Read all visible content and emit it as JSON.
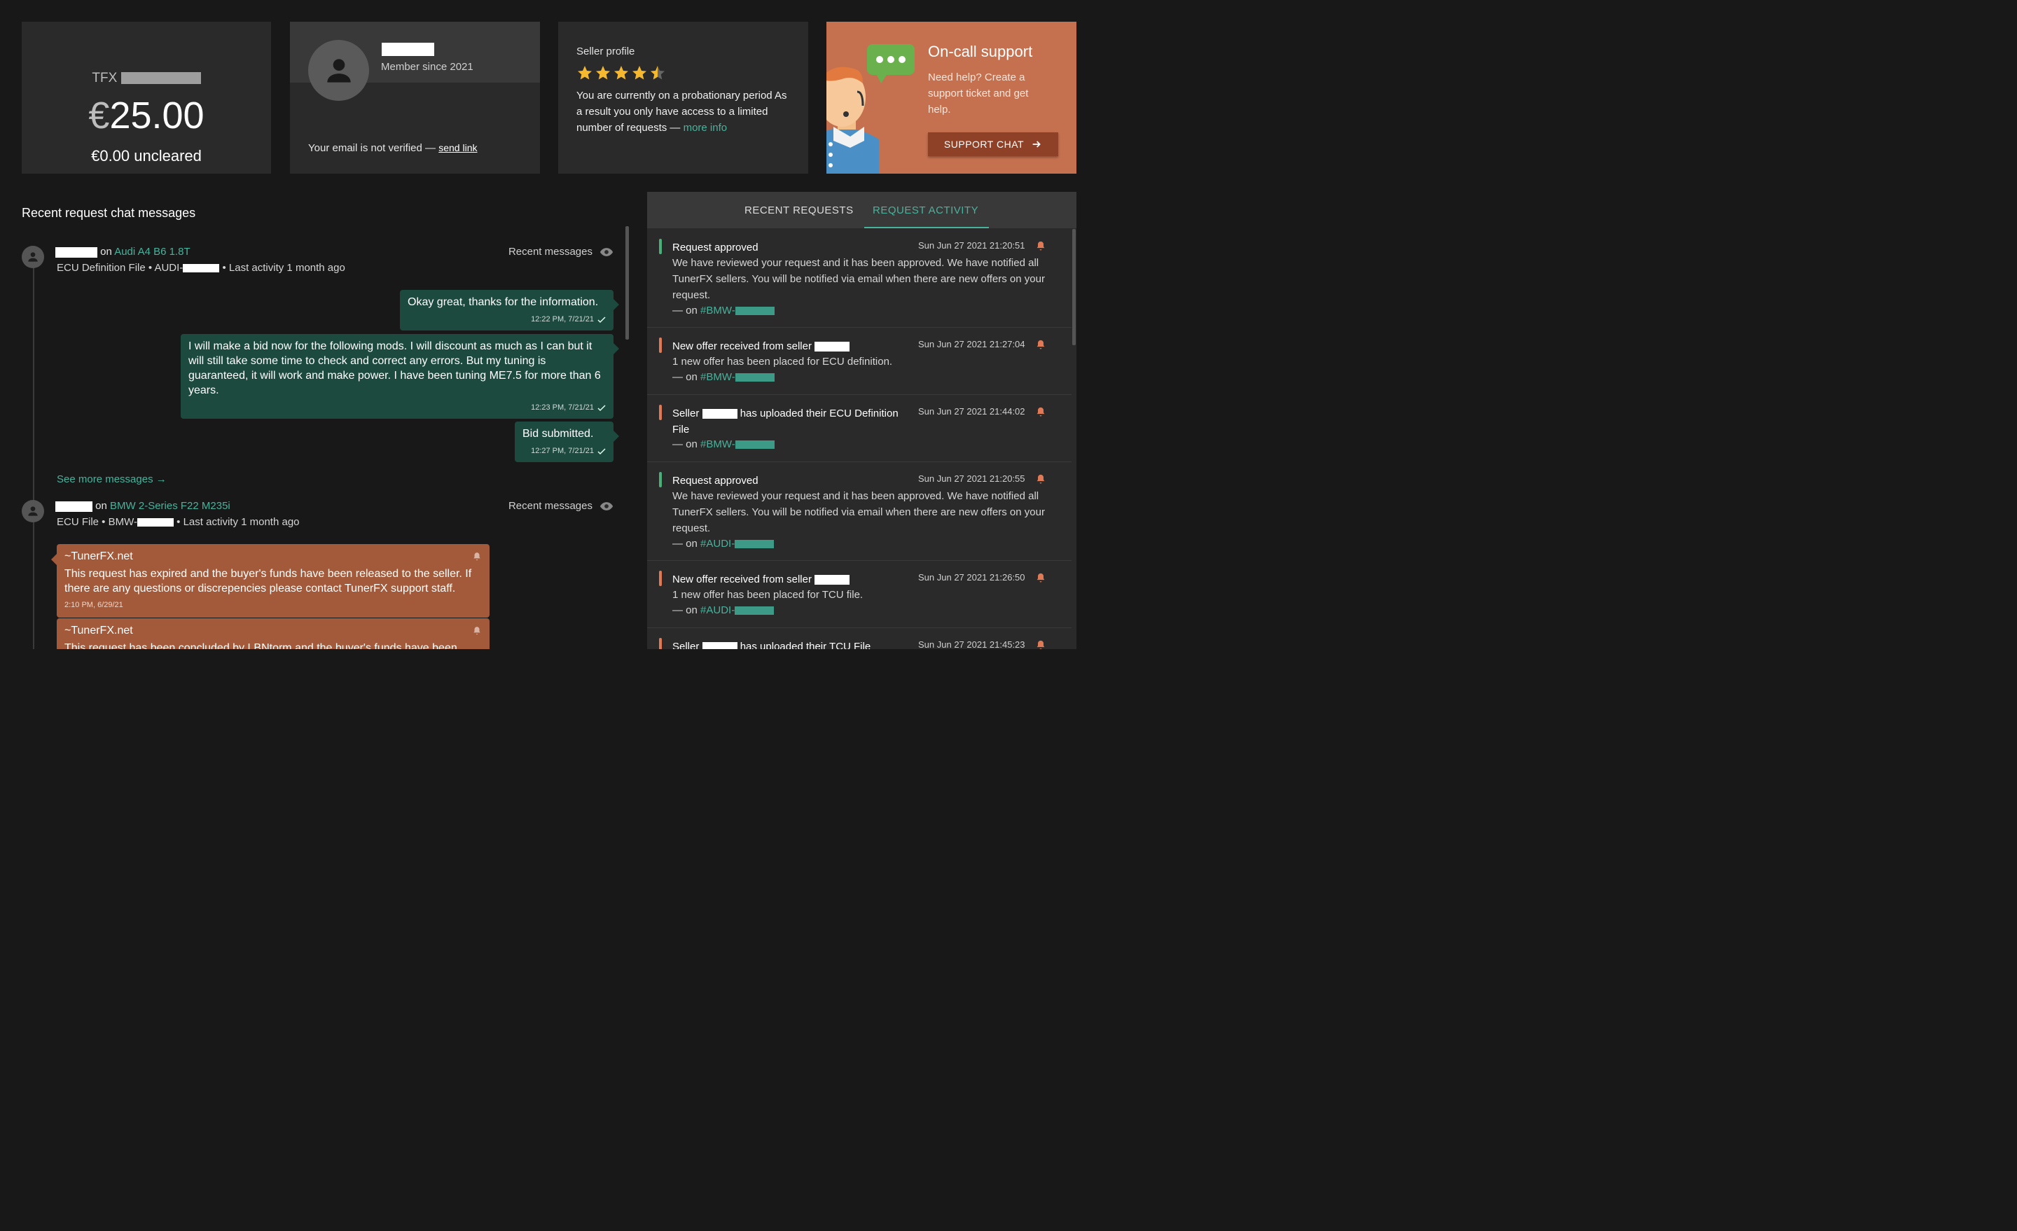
{
  "balance": {
    "currency": "TFX",
    "symbol": "€",
    "amount": "25.00",
    "uncleared": "€0.00 uncleared"
  },
  "profile": {
    "member_since": "Member since 2021",
    "email_status": "Your email is not verified",
    "dash": "—",
    "send_link": "send link"
  },
  "seller": {
    "title": "Seller profile",
    "rating": 4.5,
    "text": "You are currently on a probationary period As a result you only have access to a limited number of requests",
    "dash": "—",
    "more_info": "more info",
    "star_color": "#f5b82e"
  },
  "support": {
    "title": "On-call support",
    "description": "Need help? Create a support ticket and get help.",
    "button": "SUPPORT CHAT",
    "accent": "#c5714f"
  },
  "chat": {
    "title": "Recent request chat messages",
    "recent_messages_label": "Recent messages",
    "see_more": "See more messages →",
    "threads": [
      {
        "on": "on",
        "vehicle": "Audi A4 B6 1.8T",
        "file": "ECU Definition File • AUDI-",
        "activity": "Last activity 1 month ago",
        "messages": [
          {
            "text": "Okay great, thanks for the information.",
            "time": "12:22 PM, 7/21/21"
          },
          {
            "text": "I will make a bid now for the following mods. I will discount as much as I can but it will still take some time to check and correct any errors. But my tuning is guaranteed, it will work and make power. I have been tuning ME7.5 for more than 6 years.",
            "time": "12:23 PM, 7/21/21"
          },
          {
            "text": "Bid submitted.",
            "time": "12:27 PM, 7/21/21"
          }
        ]
      },
      {
        "on": "on",
        "vehicle": "BMW 2-Series F22 M235i",
        "file": "ECU File • BMW-",
        "activity": "Last activity 1 month ago",
        "system_messages": [
          {
            "from": "~TunerFX.net",
            "text": "This request has expired and the buyer's funds have been released to the seller. If there are any questions or discrepencies please contact TunerFX support staff.",
            "time": "2:10 PM, 6/29/21"
          },
          {
            "from": "~TunerFX.net",
            "text": "This request has been concluded by LBNtorm and the buyer's funds have been released to the seller.",
            "time": ""
          }
        ]
      }
    ]
  },
  "activity": {
    "tabs": [
      {
        "label": "RECENT REQUESTS",
        "active": false
      },
      {
        "label": "REQUEST ACTIVITY",
        "active": true
      }
    ],
    "items": [
      {
        "title": "Request approved",
        "date": "Sun Jun 27 2021 21:20:51",
        "body": "We have reviewed your request and it has been approved. We have notified all TunerFX sellers. You will be notified via email when there are new offers on your request.",
        "on": "— on",
        "ref": "#BMW-",
        "color": "#4caf7a"
      },
      {
        "title": "New offer received from seller",
        "date": "Sun Jun 27 2021 21:27:04",
        "body": "1 new offer has been placed for ECU definition.",
        "on": "— on",
        "ref": "#BMW-",
        "color": "#e07a56"
      },
      {
        "title_pre": "Seller",
        "title": "has uploaded their ECU Definition File",
        "date": "Sun Jun 27 2021 21:44:02",
        "on": "— on",
        "ref": "#BMW-",
        "color": "#e07a56"
      },
      {
        "title": "Request approved",
        "date": "Sun Jun 27 2021 21:20:55",
        "body": "We have reviewed your request and it has been approved. We have notified all TunerFX sellers. You will be notified via email when there are new offers on your request.",
        "on": "— on",
        "ref": "#AUDI-",
        "color": "#4caf7a"
      },
      {
        "title": "New offer received from seller",
        "date": "Sun Jun 27 2021 21:26:50",
        "body": "1 new offer has been placed for TCU file.",
        "on": "— on",
        "ref": "#AUDI-",
        "color": "#e07a56"
      },
      {
        "title_pre": "Seller",
        "title": "has uploaded their TCU File",
        "date": "Sun Jun 27 2021 21:45:23",
        "color": "#e07a56"
      }
    ]
  }
}
